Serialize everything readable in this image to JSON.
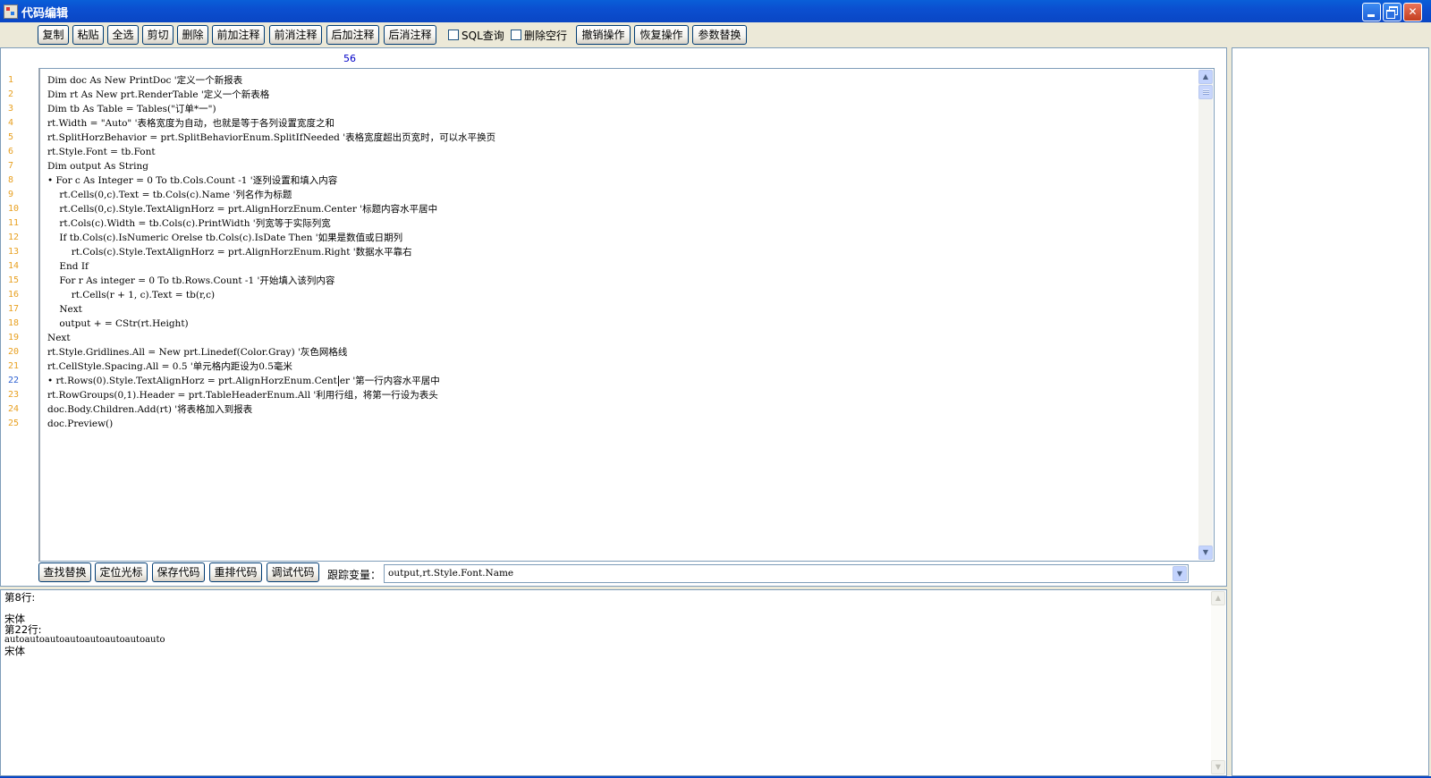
{
  "window": {
    "title": "代码编辑",
    "minimize": "_",
    "close": "✕"
  },
  "toolbar": {
    "buttons": [
      "复制",
      "粘贴",
      "全选",
      "剪切",
      "删除",
      "前加注释",
      "前消注释",
      "后加注释",
      "后消注释"
    ],
    "sql_query_label": "SQL查询",
    "delete_blank_label": "删除空行",
    "buttons2": [
      "撤销操作",
      "恢复操作",
      "参数替换"
    ]
  },
  "editor": {
    "position_indicator": "56",
    "current_line": 22,
    "line_numbers": [
      "1",
      "2",
      "3",
      "4",
      "5",
      "6",
      "7",
      "8",
      "9",
      "10",
      "11",
      "12",
      "13",
      "14",
      "15",
      "16",
      "17",
      "18",
      "19",
      "20",
      "21",
      "22",
      "23",
      "24",
      "25"
    ],
    "lines": [
      "Dim doc As New PrintDoc '定义一个新报表",
      "Dim rt As New prt.RenderTable '定义一个新表格",
      "Dim tb As Table = Tables(\"订单*一\")",
      "rt.Width = \"Auto\" '表格宽度为自动，也就是等于各列设置宽度之和",
      "rt.SplitHorzBehavior = prt.SplitBehaviorEnum.SplitIfNeeded '表格宽度超出页宽时，可以水平换页",
      "rt.Style.Font = tb.Font",
      "Dim output As String",
      "• For c As Integer = 0 To tb.Cols.Count -1 '逐列设置和填入内容",
      "    rt.Cells(0,c).Text = tb.Cols(c).Name '列名作为标题",
      "    rt.Cells(0,c).Style.TextAlignHorz = prt.AlignHorzEnum.Center '标题内容水平居中",
      "    rt.Cols(c).Width = tb.Cols(c).PrintWidth '列宽等于实际列宽",
      "    If tb.Cols(c).IsNumeric Orelse tb.Cols(c).IsDate Then '如果是数值或日期列",
      "        rt.Cols(c).Style.TextAlignHorz = prt.AlignHorzEnum.Right '数据水平靠右",
      "    End If",
      "    For r As integer = 0 To tb.Rows.Count -1 '开始填入该列内容",
      "        rt.Cells(r + 1, c).Text = tb(r,c)",
      "    Next",
      "    output + = CStr(rt.Height)",
      "Next",
      "rt.Style.Gridlines.All = New prt.Linedef(Color.Gray) '灰色网格线",
      "rt.CellStyle.Spacing.All = 0.5 '单元格内距设为0.5毫米",
      "",
      "rt.RowGroups(0,1).Header = prt.TableHeaderEnum.All '利用行组，将第一行设为表头",
      "doc.Body.Children.Add(rt) '将表格加入到报表",
      "doc.Preview()"
    ],
    "line22_before_caret": "• rt.Rows(0).Style.TextAlignHorz = prt.AlignHorzEnum.Cent",
    "line22_after_caret": "er '第一行内容水平居中"
  },
  "bottom": {
    "buttons": [
      "查找替换",
      "定位光标",
      "保存代码",
      "重排代码",
      "调试代码"
    ],
    "track_label": "跟踪变量：",
    "track_value": "output,rt.Style.Font.Name"
  },
  "output": {
    "lines": [
      "第8行:",
      "",
      "宋体",
      "第22行:",
      "autoautoautoautoautoautoautoauto",
      "宋体"
    ]
  },
  "icons": {
    "scroll_up": "▲",
    "scroll_down": "▼",
    "dropdown": "▼"
  }
}
